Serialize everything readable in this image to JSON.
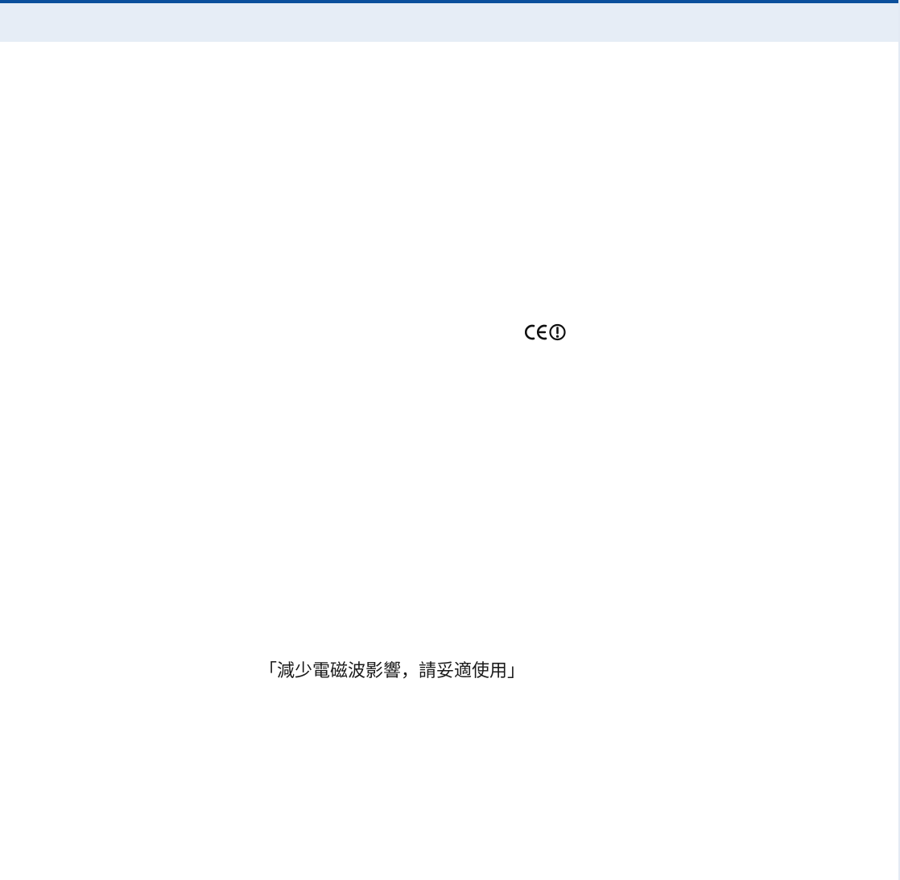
{
  "header": {
    "accent_color": "#0b4f9c",
    "band_color": "#e6edf6"
  },
  "marks": {
    "certification_icon": "ce-alert-icon"
  },
  "notice": {
    "text": "「減少電磁波影響，請妥適使用」"
  }
}
